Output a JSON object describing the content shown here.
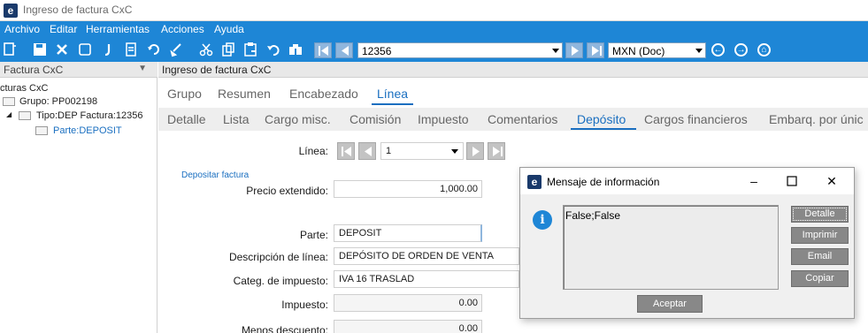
{
  "window": {
    "title": "Ingreso de factura CxC",
    "logo_letter": "e"
  },
  "menu": [
    "Archivo",
    "Editar",
    "Herramientas",
    "Acciones",
    "Ayuda"
  ],
  "toolbar": {
    "icons": [
      "new-icon",
      "save-icon",
      "delete-icon",
      "copy-icon",
      "attach-icon",
      "print-icon",
      "refresh-icon",
      "clear-icon",
      "cut-icon",
      "copy-clip-icon",
      "paste-icon",
      "undo-icon",
      "find-icon"
    ],
    "key_value": "12356",
    "currency_value": "MXN (Doc)"
  },
  "tree_panel": {
    "title": "Factura CxC",
    "items": [
      "cturas CxC",
      "Grupo: PP002198",
      "Tipo:DEP Factura:12356",
      "Parte:DEPOSIT"
    ]
  },
  "content": {
    "title": "Ingreso de factura CxC",
    "tabs_top": [
      "Grupo",
      "Resumen",
      "Encabezado",
      "Línea"
    ],
    "tabs_sub": [
      "Detalle",
      "Lista",
      "Cargo misc.",
      "Comisión",
      "Impuesto",
      "Comentarios",
      "Depósito",
      "Cargos financieros",
      "Embarq. por únic"
    ],
    "line_label": "Línea:",
    "line_value": "1",
    "section_title": "Depositar factura",
    "fields": {
      "precio_label": "Precio extendido:",
      "precio_value": "1,000.00",
      "parte_label": "Parte:",
      "parte_value": "DEPOSIT",
      "desc_label": "Descripción de línea:",
      "desc_value": "DEPÓSITO DE ORDEN DE VENTA",
      "categ_label": "Categ. de impuesto:",
      "categ_value": "IVA 16 TRASLAD",
      "impuesto_label": "Impuesto:",
      "impuesto_value": "0.00",
      "menos_label": "Menos descuento:",
      "menos_value": "0.00"
    }
  },
  "dialog": {
    "title": "Mensaje de información",
    "message": "False;False",
    "buttons": {
      "detail": "Detalle",
      "print": "Imprimir",
      "email": "Email",
      "copy": "Copiar",
      "ok": "Aceptar"
    }
  }
}
